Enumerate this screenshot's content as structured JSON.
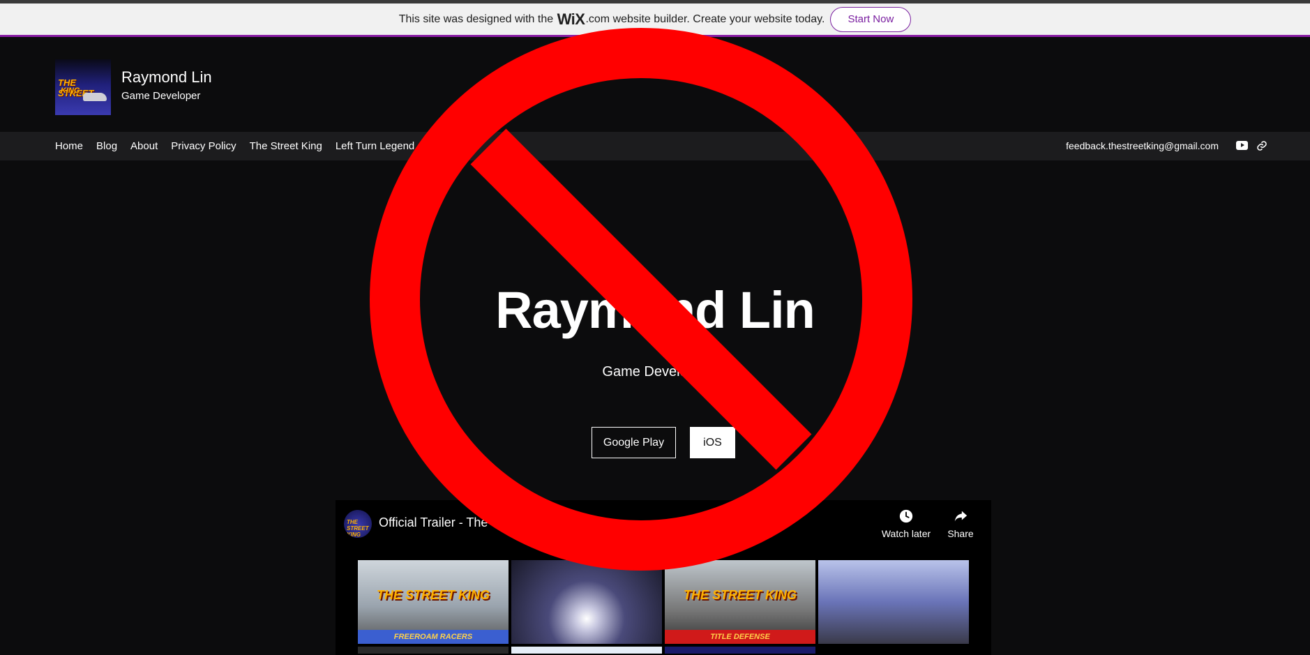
{
  "wix_banner": {
    "text_before": "This site was designed with the",
    "logo": "WiX",
    "text_after": ".com website builder. Create your website today.",
    "cta": "Start Now"
  },
  "header": {
    "logo_text_1": "THE STREET",
    "logo_text_2": "KING",
    "name": "Raymond Lin",
    "tagline": "Game Developer"
  },
  "nav": {
    "items": [
      "Home",
      "Blog",
      "About",
      "Privacy Policy",
      "The Street King",
      "Left Turn Legend"
    ],
    "email": "feedback.thestreetking@gmail.com",
    "social": [
      "youtube-icon",
      "link-icon"
    ]
  },
  "hero": {
    "title": "Raymond Lin",
    "subtitle": "Game Developer",
    "button_google": "Google Play",
    "button_ios": "iOS"
  },
  "video": {
    "channel_logo_text": "THE STREET KING",
    "title": "Official Trailer - The Street King",
    "watch_later": "Watch later",
    "share": "Share",
    "thumbs": [
      {
        "title": "THE STREET KING",
        "caption": "FREEROAM RACERS"
      },
      {
        "title": "",
        "caption": ""
      },
      {
        "title": "THE STREET KING",
        "caption": "TITLE DEFENSE"
      },
      {
        "title": "",
        "caption": ""
      }
    ]
  },
  "overlay": {
    "symbol": "prohibition-sign",
    "color": "#ff0000"
  },
  "colors": {
    "accent": "#8a1da5",
    "background": "#0c0c0d",
    "nav_bg": "#1c1c1e"
  }
}
